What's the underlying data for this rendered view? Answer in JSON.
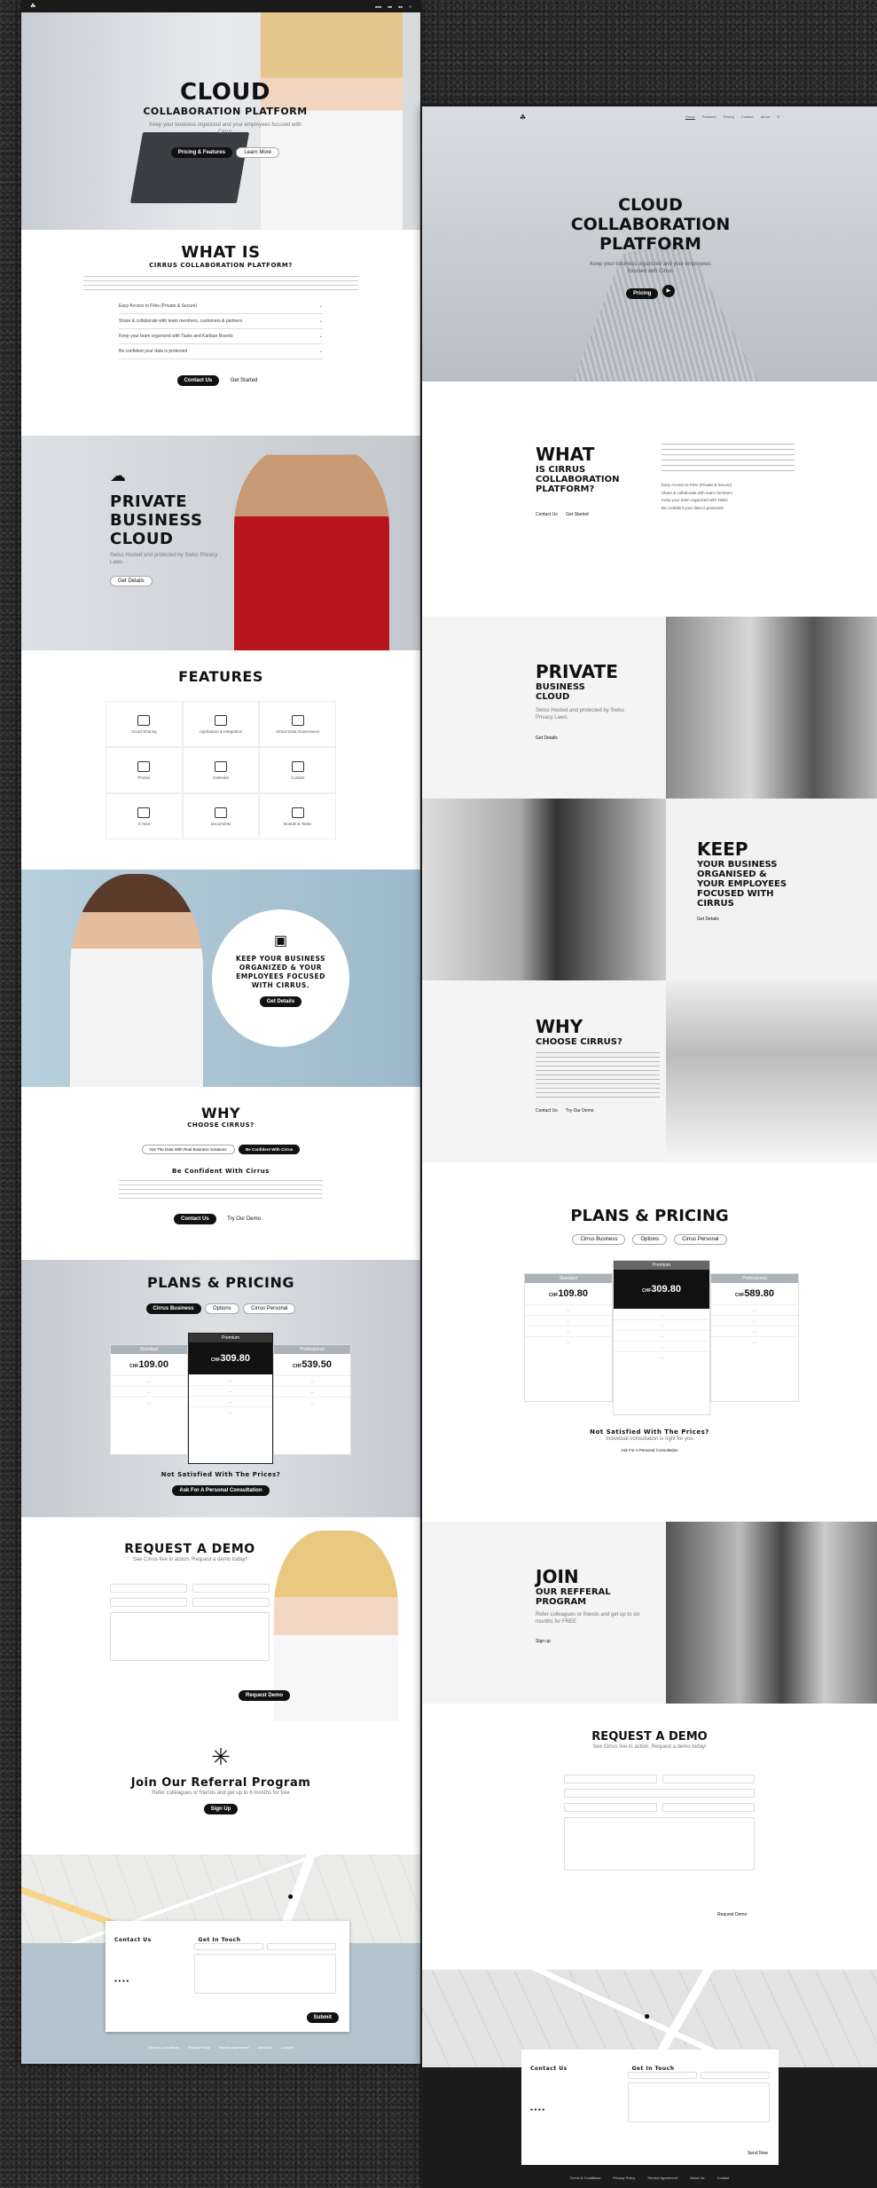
{
  "left": {
    "hero": {
      "title": "CLOUD",
      "subtitle": "COLLABORATION PLATFORM",
      "text": "Keep your business organized and your employees focused with Cirrus",
      "btn_primary": "Pricing & Features",
      "btn_secondary": "Learn More"
    },
    "what": {
      "title": "WHAT IS",
      "subtitle": "CIRRUS COLLABORATION PLATFORM?",
      "items": [
        "Easy Access to Files (Private & Secure)",
        "Share & collaborate with team members, customers & partners",
        "Keep your team organized with Tasks and Kanban Boards",
        "Be confident your data is protected"
      ],
      "btn1": "Contact Us",
      "btn2": "Get Started"
    },
    "private": {
      "l1": "PRIVATE",
      "l2": "BUSINESS",
      "l3": "CLOUD",
      "text": "Swiss Hosted and protected by Swiss Privacy Laws.",
      "btn": "Get Details"
    },
    "features": {
      "title": "FEATURES",
      "items": [
        "Cloud Sharing",
        "Application & Integration",
        "Virtual Data Governance",
        "Photos",
        "Calendar",
        "Contact",
        "E-mail",
        "Documents",
        "Boards & Tasks"
      ]
    },
    "keep": {
      "text": "KEEP YOUR BUSINESS ORGANIZED & YOUR EMPLOYEES FOCUSED WITH CIRRUS.",
      "btn": "Get Details"
    },
    "why": {
      "title": "WHY",
      "subtitle": "CHOOSE CIRRUS?",
      "tab1": "Get The Data With Real Business Solutions",
      "tab2": "Be Confident With Cirrus",
      "heading": "Be Confident With Cirrus",
      "btn1": "Contact Us",
      "btn2": "Try Our Demo"
    },
    "plans": {
      "title": "PLANS & PRICING",
      "tabs": [
        "Cirrus Business",
        "Options",
        "Cirrus Personal"
      ],
      "cards": [
        {
          "name": "Standard",
          "price": "109.00"
        },
        {
          "name": "Premium",
          "price": "309.80"
        },
        {
          "name": "Professional",
          "price": "539.50"
        }
      ],
      "note": "Not Satisfied With The Prices?",
      "btn": "Ask For A Personal Consultation"
    },
    "demo": {
      "title": "REQUEST A DEMO",
      "sub": "See Cirrus live in action. Request a demo today!",
      "btn": "Request Demo"
    },
    "referral": {
      "title": "Join Our Referral Program",
      "sub": "Refer colleagues or friends and get up to 6 months for free",
      "btn": "Sign Up"
    },
    "contact": {
      "h1": "Contact Us",
      "h2": "Get In Touch",
      "btn": "Submit"
    },
    "footer": [
      "Terms & Conditions",
      "Privacy Policy",
      "Service Agreement",
      "About Us",
      "Contact"
    ]
  },
  "right": {
    "nav": [
      "Home",
      "Features",
      "Pricing",
      "Contact",
      "About"
    ],
    "hero": {
      "l1": "CLOUD",
      "l2": "COLLABORATION",
      "l3": "PLATFORM",
      "text": "Keep your business organized and your employees focused with Cirrus",
      "btn": "Pricing"
    },
    "what": {
      "l1": "WHAT",
      "l2": "IS CIRRUS",
      "l3": "COLLABORATION",
      "l4": "PLATFORM?",
      "btn1": "Contact Us",
      "btn2": "Get Started",
      "bullets": [
        "Easy Access to Files (Private & Secure)",
        "Share & collaborate with team members",
        "Keep your team organized with Tasks",
        "Be confident your data is protected"
      ]
    },
    "private": {
      "l1": "PRIVATE",
      "l2": "BUSINESS",
      "l3": "CLOUD",
      "text": "Swiss Hosted and protected by Swiss Privacy Laws.",
      "btn": "Get Details"
    },
    "keep": {
      "l1": "KEEP",
      "l2": "YOUR BUSINESS",
      "l3": "ORGANISED &",
      "l4": "YOUR EMPLOYEES",
      "l5": "FOCUSED WITH",
      "l6": "CIRRUS",
      "btn": "Get Details"
    },
    "why": {
      "l1": "WHY",
      "l2": "CHOOSE CIRRUS?",
      "btn1": "Contact Us",
      "btn2": "Try Our Demo"
    },
    "plans": {
      "title": "PLANS & PRICING",
      "tabs": [
        "Cirrus Business",
        "Options",
        "Cirrus Personal"
      ],
      "cards": [
        {
          "name": "Standard",
          "price": "109.80"
        },
        {
          "name": "Premium",
          "price": "309.80"
        },
        {
          "name": "Professional",
          "price": "589.80"
        }
      ],
      "note": "Not Satisfied With The Prices?",
      "sub": "Individual consultation is right for you",
      "link": "Ask For A Personal Consultation"
    },
    "join": {
      "l1": "JOIN",
      "l2": "OUR REFFERAL",
      "l3": "PROGRAM",
      "text": "Refer colleagues or friends and get up to six months for FREE",
      "btn": "Sign up"
    },
    "demo": {
      "title": "REQUEST A DEMO",
      "sub": "See Cirrus live in action. Request a demo today!",
      "btn": "Request Demo"
    },
    "contact": {
      "h1": "Contact Us",
      "h2": "Get In Touch",
      "btn": "Send Now"
    },
    "footer": [
      "Terms & Conditions",
      "Privacy Policy",
      "Service Agreement",
      "About Us",
      "Contact"
    ]
  }
}
